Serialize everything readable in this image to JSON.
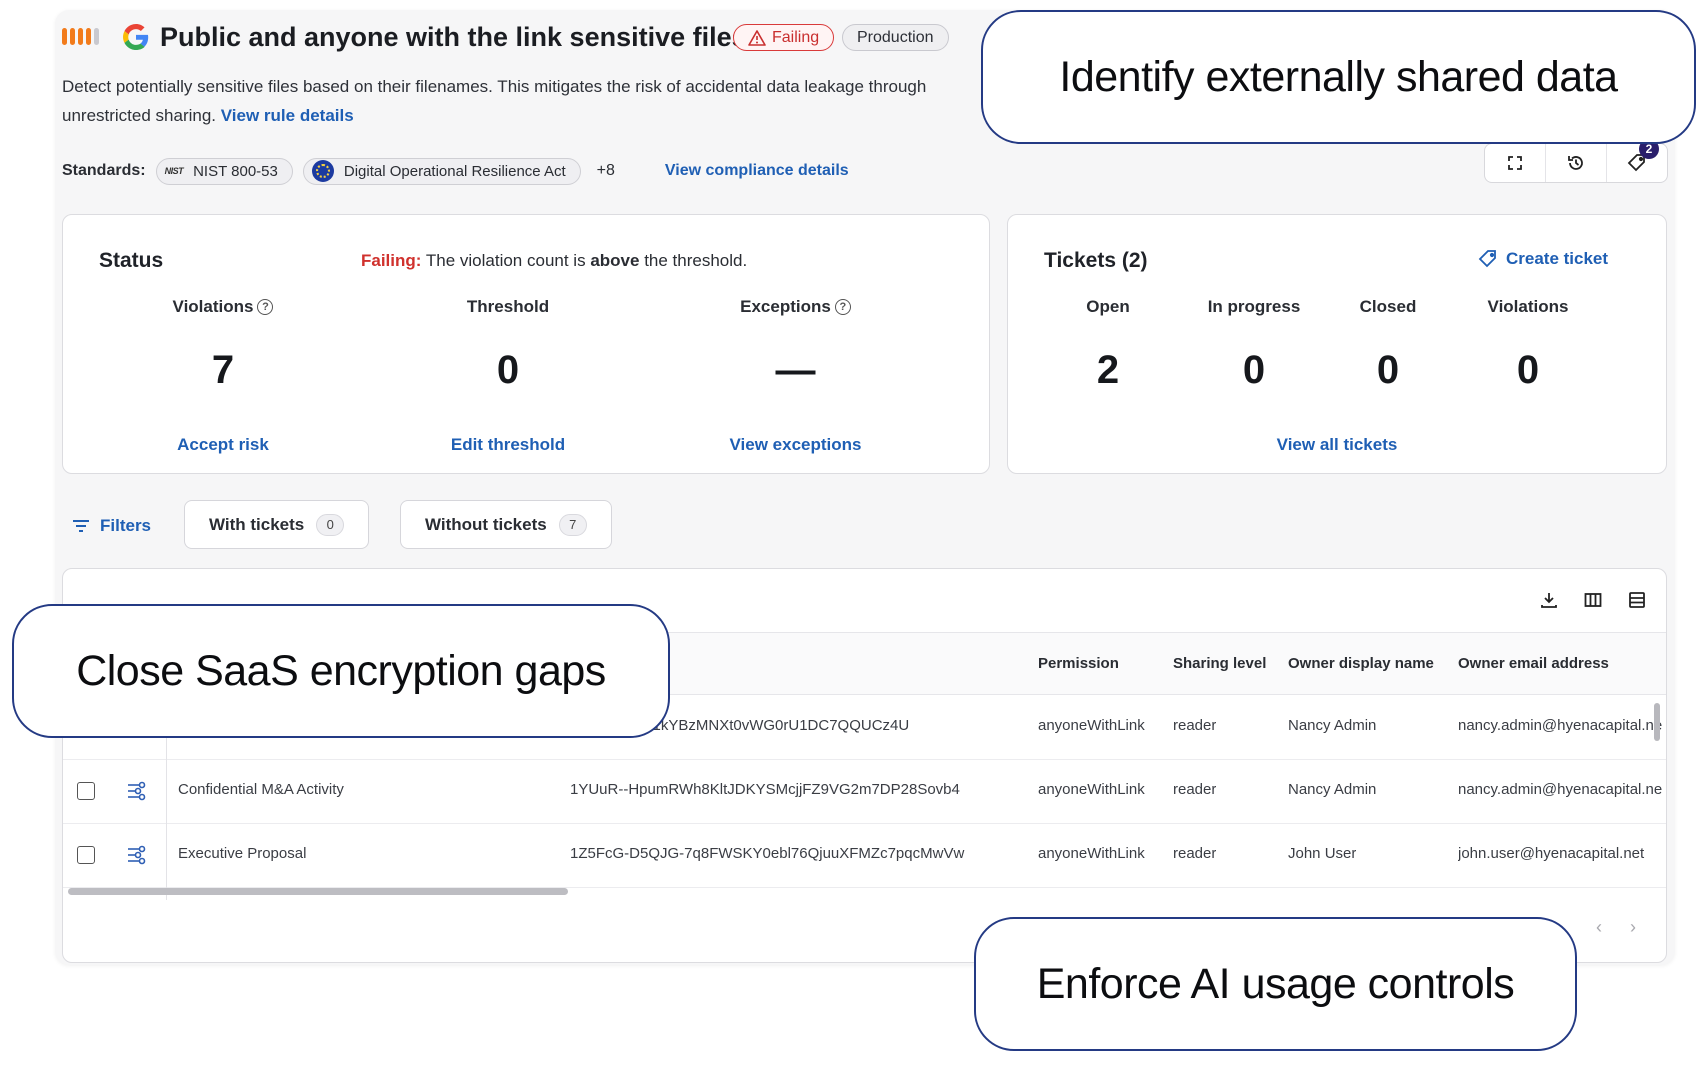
{
  "header": {
    "title": "Public and anyone with the link sensitive files",
    "status_pill": "Failing",
    "env_pill": "Production",
    "description": "Detect potentially sensitive files based on their filenames. This mitigates the risk of accidental data leakage through unrestricted sharing.",
    "rule_link": "View rule details",
    "severity_level": 4,
    "severity_max": 5
  },
  "standards": {
    "label": "Standards:",
    "items": [
      "NIST 800-53",
      "Digital Operational Resilience Act"
    ],
    "more": "+8",
    "compliance_link": "View compliance details",
    "history_badge": "2"
  },
  "status": {
    "title": "Status",
    "message_prefix": "Failing:",
    "message_mid": "The violation count is",
    "message_bold": "above",
    "message_suffix": "the threshold.",
    "metrics": [
      {
        "label": "Violations",
        "value": "7",
        "link": "Accept risk"
      },
      {
        "label": "Threshold",
        "value": "0",
        "link": "Edit threshold"
      },
      {
        "label": "Exceptions",
        "value": "—",
        "link": "View exceptions"
      }
    ]
  },
  "tickets": {
    "title": "Tickets (2)",
    "create": "Create ticket",
    "metrics": [
      {
        "label": "Open",
        "value": "2"
      },
      {
        "label": "In progress",
        "value": "0"
      },
      {
        "label": "Closed",
        "value": "0"
      },
      {
        "label": "Violations",
        "value": "0"
      }
    ],
    "view_all": "View all tickets"
  },
  "filters": {
    "label": "Filters",
    "with_tickets": "With tickets",
    "with_count": "0",
    "without_tickets": "Without tickets",
    "without_count": "7"
  },
  "table": {
    "columns": [
      "Permission",
      "Sharing level",
      "Owner display name",
      "Owner email address"
    ],
    "rows": [
      {
        "name": "",
        "id": "1CBkcM1cV1kYBzMNXt0vWG0rU1DC7QQUCz4U",
        "permission": "anyoneWithLink",
        "sharing": "reader",
        "owner": "Nancy Admin",
        "email": "nancy.admin@hyenacapital.ne"
      },
      {
        "name": "Confidential M&A Activity",
        "id": "1YUuR--HpumRWh8KltJDKYSMcjjFZ9VG2m7DP28Sovb4",
        "permission": "anyoneWithLink",
        "sharing": "reader",
        "owner": "Nancy Admin",
        "email": "nancy.admin@hyenacapital.ne"
      },
      {
        "name": "Executive Proposal",
        "id": "1Z5FcG-D5QJG-7q8FWSKY0ebl76QjuuXFMZc7pqcMwVw",
        "permission": "anyoneWithLink",
        "sharing": "reader",
        "owner": "John User",
        "email": "john.user@hyenacapital.net"
      }
    ]
  },
  "callouts": {
    "top": "Identify externally shared data",
    "left": "Close SaaS encryption gaps",
    "bottom": "Enforce AI usage controls"
  },
  "colors": {
    "accent": "#1f5fb4",
    "failing": "#d0312d",
    "severity": "#f27b1b",
    "callout_border": "#243a84"
  }
}
